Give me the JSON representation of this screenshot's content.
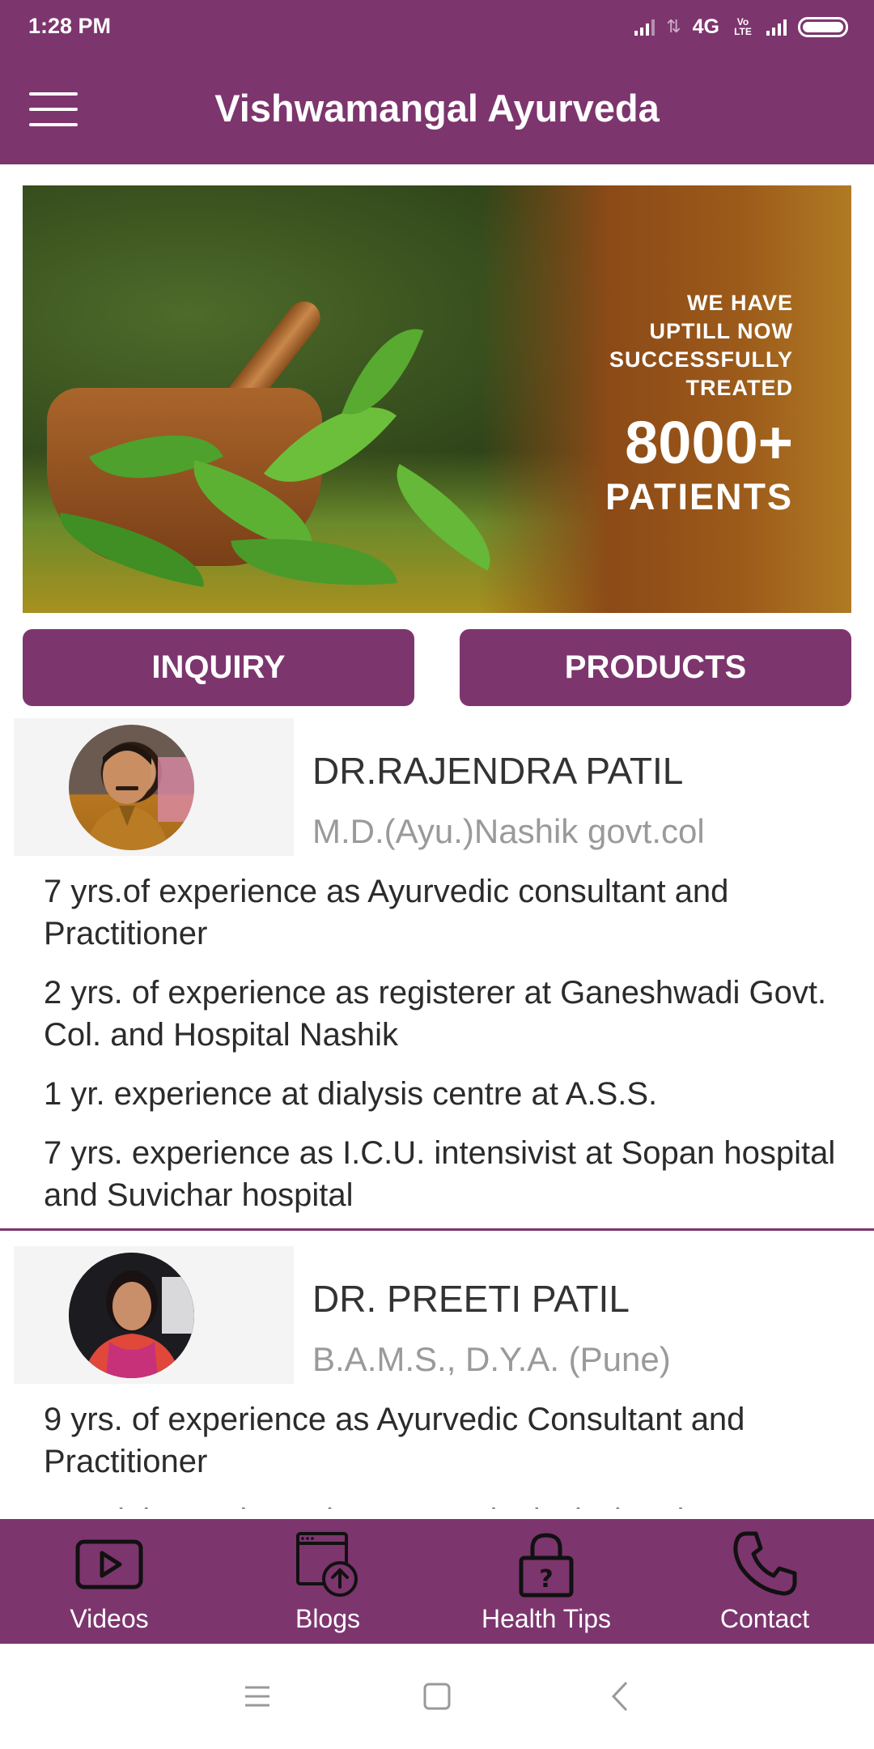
{
  "status_bar": {
    "time": "1:28 PM",
    "network": "4G",
    "volte": "Vo LTE"
  },
  "app_bar": {
    "title": "Vishwamangal Ayurveda"
  },
  "banner": {
    "line1": "WE HAVE",
    "line2": "UPTILL NOW",
    "line3": "SUCCESSFULLY",
    "line4": "TREATED",
    "count": "8000+",
    "unit": "PATIENTS"
  },
  "actions": {
    "inquiry_label": "INQUIRY",
    "products_label": "PRODUCTS"
  },
  "doctors": [
    {
      "name": "DR.RAJENDRA PATIL",
      "qualification": "M.D.(Ayu.)Nashik govt.col",
      "points": [
        "7 yrs.of experience as Ayurvedic consultant and Practitioner",
        "2 yrs. of experience as registerer at Ganeshwadi Govt. Col. and Hospital Nashik",
        "1 yr. experience at dialysis centre at A.S.S.",
        "7 yrs. experience as I.C.U. intensivist at Sopan hospital and Suvichar hospital"
      ]
    },
    {
      "name": "DR. PREETI PATIL",
      "qualification": "B.A.M.S., D.Y.A. (Pune)",
      "points": [
        "9 yrs. of experience as Ayurvedic Consultant and Practitioner",
        "Special experience in Gynaecological Disorders"
      ]
    }
  ],
  "bottom_nav": [
    {
      "label": "Videos",
      "icon": "video-play-icon"
    },
    {
      "label": "Blogs",
      "icon": "blog-upload-icon"
    },
    {
      "label": "Health Tips",
      "icon": "lock-question-icon"
    },
    {
      "label": "Contact",
      "icon": "phone-icon"
    }
  ],
  "colors": {
    "primary": "#7d356e",
    "text": "#2b2b2b",
    "muted": "#9a9a9a"
  }
}
